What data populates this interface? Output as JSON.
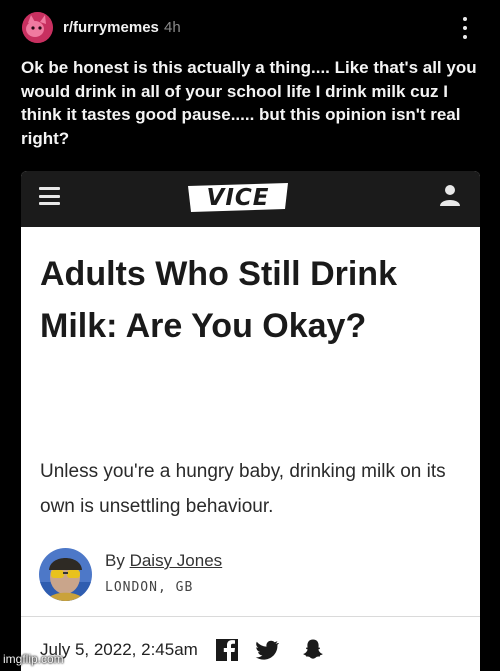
{
  "post": {
    "subreddit": "r/furrymemes",
    "age": "4h",
    "title": "Ok be honest is this actually a thing.... Like that's all you would drink in all of your school life I drink milk cuz I think it tastes good pause..... but this opinion isn't real right?"
  },
  "article": {
    "site_logo": "VICE",
    "headline": "Adults Who Still Drink Milk: Are You Okay?",
    "subheading": "Unless you're a hungry baby, drinking milk on its own is unsettling behaviour.",
    "byline_prefix": "By",
    "author": "Daisy Jones",
    "location": "LONDON, GB",
    "date": "July 5, 2022, 2:45am"
  },
  "icons": {
    "menu": "hamburger-icon",
    "account": "user-icon",
    "share": [
      "facebook-icon",
      "twitter-icon",
      "snapchat-icon"
    ]
  },
  "watermark": "imgflip.com",
  "colors": {
    "background": "#000000",
    "card_header": "#1b1b1b",
    "card": "#ffffff",
    "avatar": "#c83060"
  }
}
